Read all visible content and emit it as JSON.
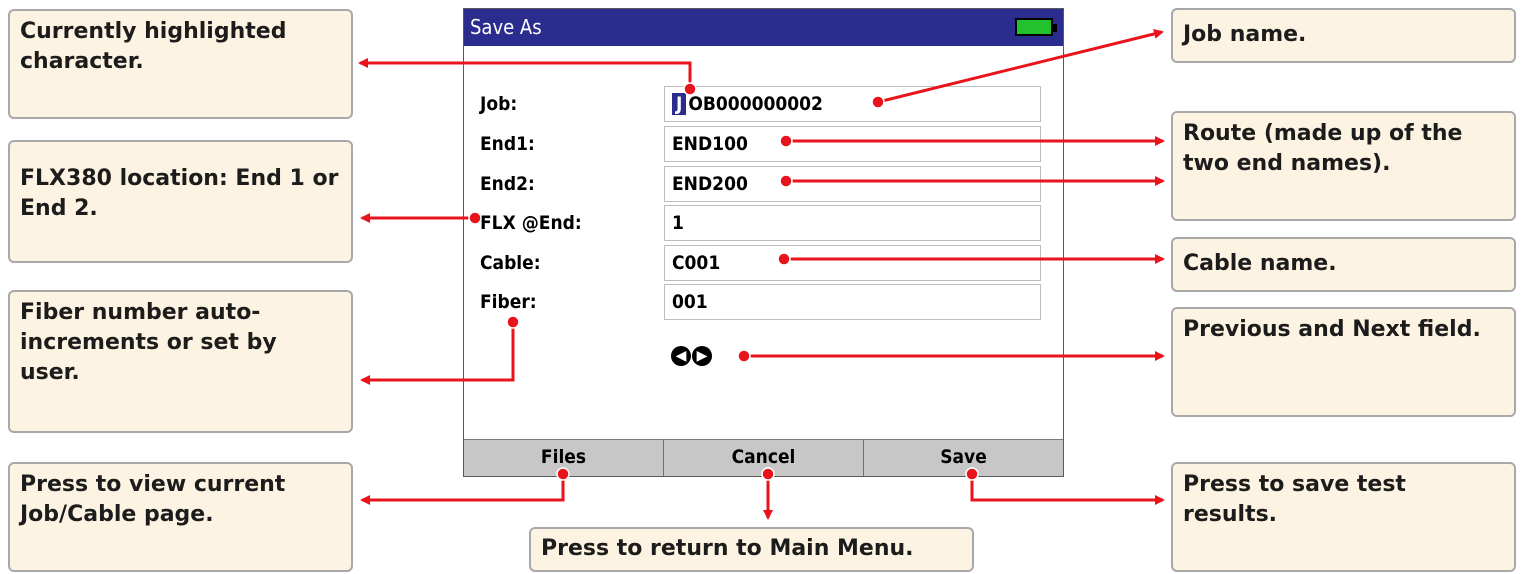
{
  "screen": {
    "title": "Save As",
    "fields": [
      {
        "label": "Job:",
        "value_highlight": "J",
        "value_rest": "OB000000002"
      },
      {
        "label": "End1:",
        "value": "END100"
      },
      {
        "label": "End2:",
        "value": "END200"
      },
      {
        "label": "FLX @End:",
        "value": "1"
      },
      {
        "label": "Cable:",
        "value": "C001"
      },
      {
        "label": "Fiber:",
        "value": "001"
      }
    ],
    "nav_icons": [
      "prev-field-icon",
      "next-field-icon"
    ],
    "softkeys": {
      "files": "Files",
      "cancel": "Cancel",
      "save": "Save"
    },
    "battery_color": "#22c22e",
    "titlebar_color": "#2b2d8e"
  },
  "callouts": {
    "highlighted_char": "Currently highlighted character.",
    "flx_location": "FLX380 location: End 1 or End 2.",
    "fiber_number": "Fiber number auto-increments or set by user.",
    "view_job": "Press to view current Job/Cable page.",
    "return_main": "Press to return to Main Menu.",
    "job_name": "Job name.",
    "route": "Route (made up of the two end names).",
    "cable_name": "Cable name.",
    "prev_next": "Previous and Next field.",
    "save_results": "Press to save test results."
  },
  "arrow_color": "#e8141c"
}
